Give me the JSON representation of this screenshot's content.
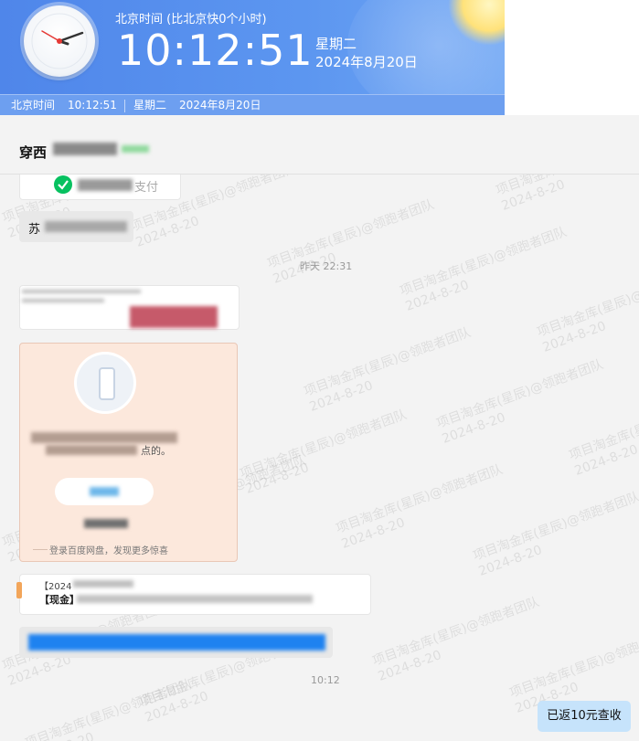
{
  "clock_widget": {
    "title": "北京时间 (比北京快0个小时)",
    "time": "10:12:51",
    "weekday": "星期二",
    "date": "2024年8月20日",
    "bar_label": "北京时间",
    "bar_time": "10:12:51",
    "bar_weekday": "星期二",
    "bar_date": "2024年8月20日"
  },
  "chat": {
    "title_visible": "穿西",
    "messages": {
      "wechat_pay_label": "支付",
      "transfer_prefix": "苏",
      "timestamp_yesterday": "昨天 22:31",
      "baidu_card_text": "点的。",
      "baidu_card_footer": "登录百度网盘，发现更多惊喜",
      "report_line1": "【2024",
      "report_line2": "【现金】",
      "timestamp_today": "10:12",
      "sent_message": "已返10元查收"
    },
    "watermark": "项目淘金库(星辰)@领跑者团队\n2024-8-20"
  },
  "colors": {
    "clock_blue": "#5b93ee",
    "wechat_green": "#07c160",
    "sent_bubble": "#c6e3fb",
    "highlight_blue": "#1e82f0"
  }
}
